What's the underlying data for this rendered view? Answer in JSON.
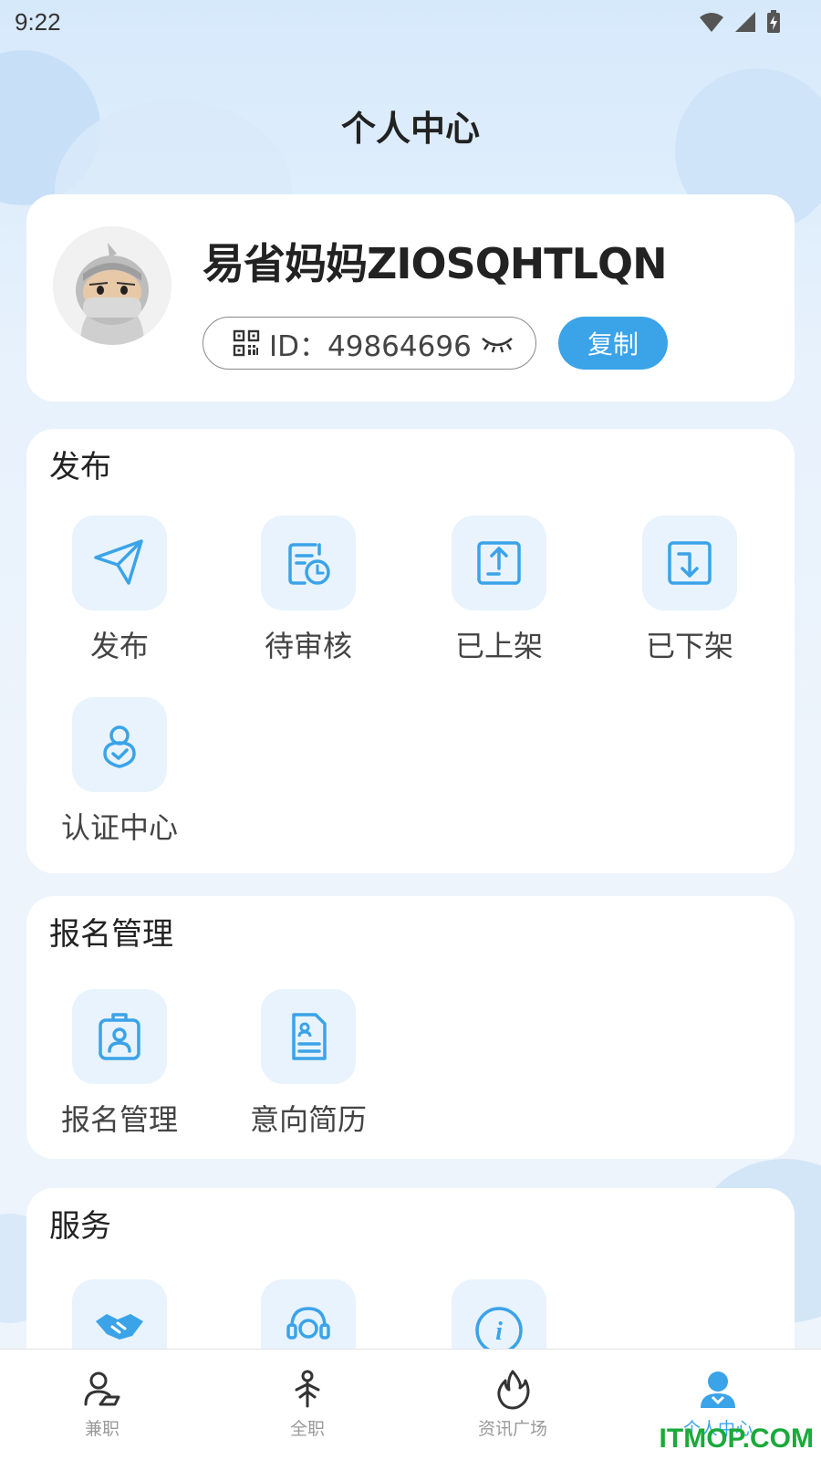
{
  "status_bar": {
    "time": "9:22"
  },
  "page": {
    "title": "个人中心"
  },
  "profile": {
    "username": "易省妈妈ZIOSQHTLQN",
    "id_text": "ID：49864696",
    "copy_label": "复制"
  },
  "publish": {
    "title": "发布",
    "items": [
      {
        "label": "发布",
        "icon": "paper-plane-icon"
      },
      {
        "label": "待审核",
        "icon": "document-clock-icon"
      },
      {
        "label": "已上架",
        "icon": "upload-box-icon"
      },
      {
        "label": "已下架",
        "icon": "download-box-icon"
      },
      {
        "label": "认证中心",
        "icon": "verified-user-icon"
      }
    ]
  },
  "signup": {
    "title": "报名管理",
    "items": [
      {
        "label": "报名管理",
        "icon": "badge-icon"
      },
      {
        "label": "意向简历",
        "icon": "resume-icon"
      }
    ]
  },
  "service": {
    "title": "服务",
    "items": [
      {
        "icon": "handshake-icon"
      },
      {
        "icon": "customer-service-icon"
      },
      {
        "icon": "info-icon"
      }
    ]
  },
  "tabbar": {
    "tabs": [
      {
        "label": "兼职",
        "icon": "part-time-icon"
      },
      {
        "label": "全职",
        "icon": "full-time-icon"
      },
      {
        "label": "资讯广场",
        "icon": "flame-icon"
      },
      {
        "label": "个人中心",
        "icon": "profile-icon",
        "active": true
      }
    ]
  },
  "watermark": "ITMOP.COM",
  "colors": {
    "accent": "#3ba3e8",
    "tile_bg": "#e8f3fd"
  }
}
